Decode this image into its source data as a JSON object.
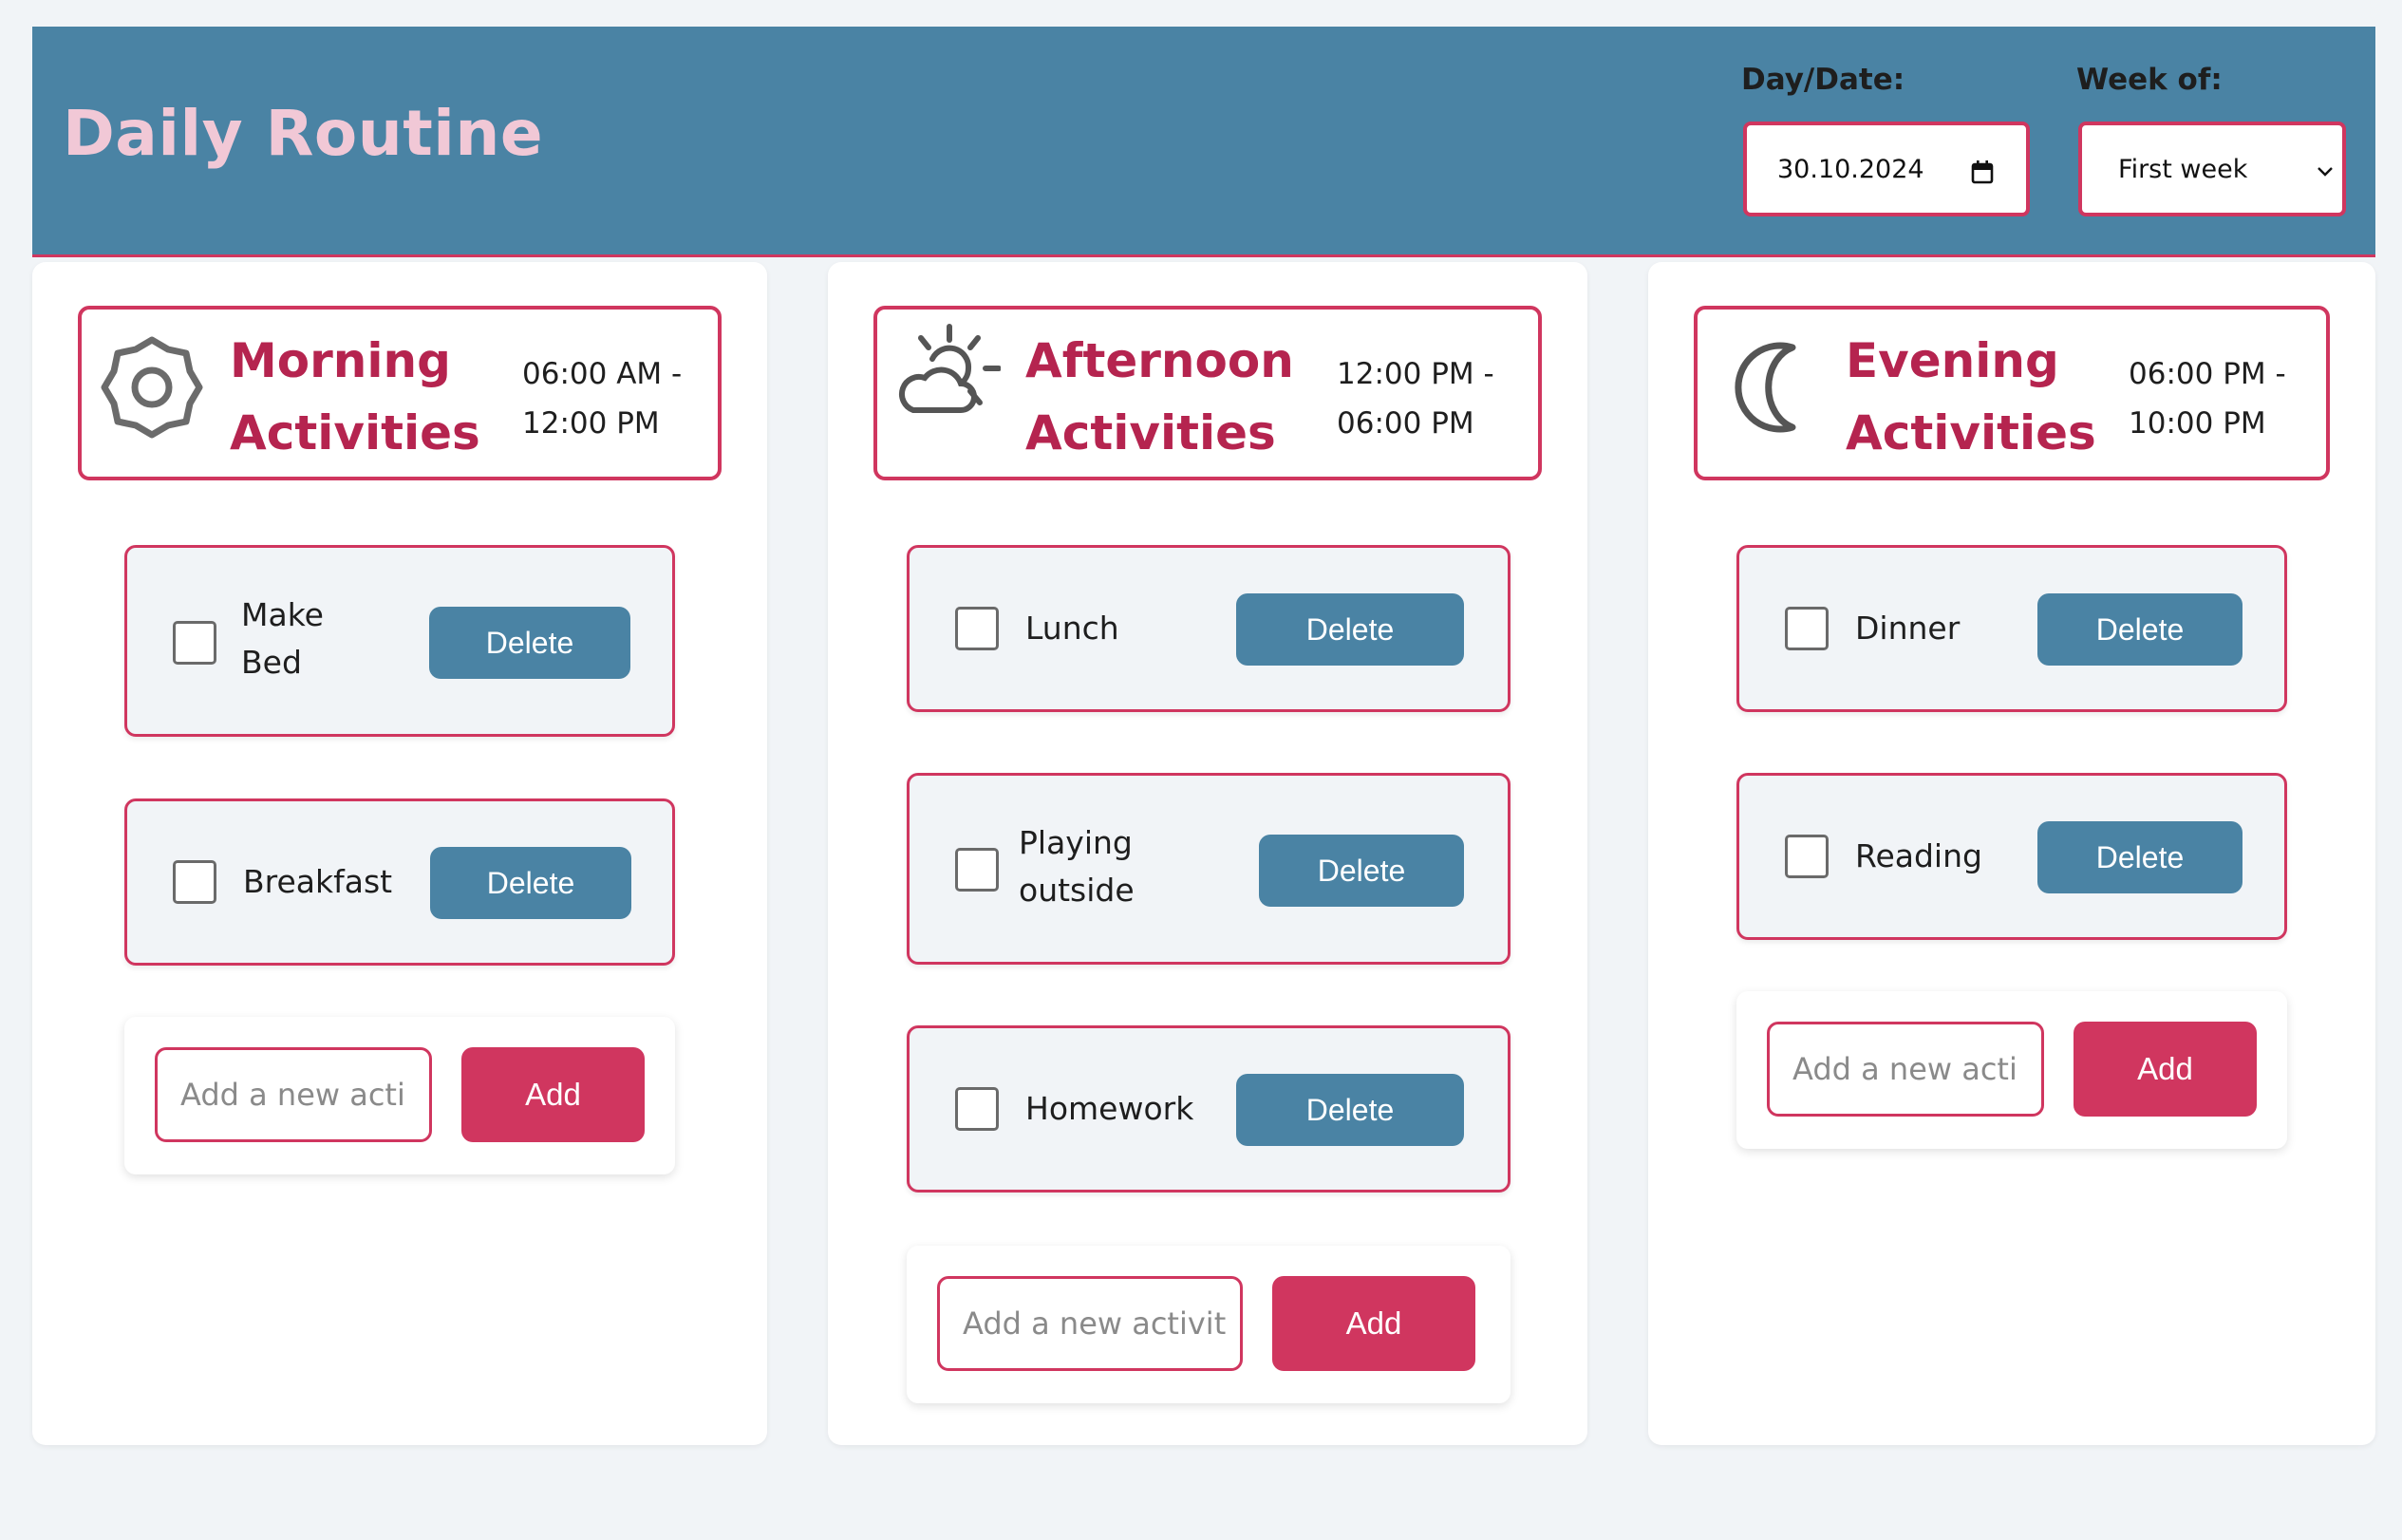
{
  "header": {
    "title": "Daily Routine",
    "date_label": "Day/Date:",
    "date_value": "30.10.2024",
    "week_label": "Week of:",
    "week_value": "First week"
  },
  "morning": {
    "title_line1": "Morning",
    "title_line2": "Activities",
    "time_line1": "06:00 AM -",
    "time_line2": "12:00 PM",
    "icon": "sun-icon",
    "tasks": [
      {
        "line1": "Make",
        "line2": "Bed",
        "delete_label": "Delete"
      },
      {
        "label": "Breakfast",
        "delete_label": "Delete"
      }
    ],
    "add_placeholder": "Add a new acti",
    "add_label": "Add"
  },
  "afternoon": {
    "title_line1": "Afternoon",
    "title_line2": "Activities",
    "time_line1": "12:00 PM -",
    "time_line2": "06:00 PM",
    "icon": "partly-cloudy-icon",
    "tasks": [
      {
        "label": "Lunch",
        "delete_label": "Delete"
      },
      {
        "line1": "Playing",
        "line2": "outside",
        "delete_label": "Delete"
      },
      {
        "label": "Homework",
        "delete_label": "Delete"
      }
    ],
    "add_placeholder": "Add a new activit",
    "add_label": "Add"
  },
  "evening": {
    "title_line1": "Evening",
    "title_line2": "Activities",
    "time_line1": "06:00 PM -",
    "time_line2": "10:00 PM",
    "icon": "moon-icon",
    "tasks": [
      {
        "label": "Dinner",
        "delete_label": "Delete"
      },
      {
        "label": "Reading",
        "delete_label": "Delete"
      }
    ],
    "add_placeholder": "Add a new acti",
    "add_label": "Add"
  },
  "colors": {
    "header_bg": "#4a83a4",
    "accent": "#d0365f",
    "title_pink": "#f1c8d6",
    "heading_red": "#b5244f"
  }
}
